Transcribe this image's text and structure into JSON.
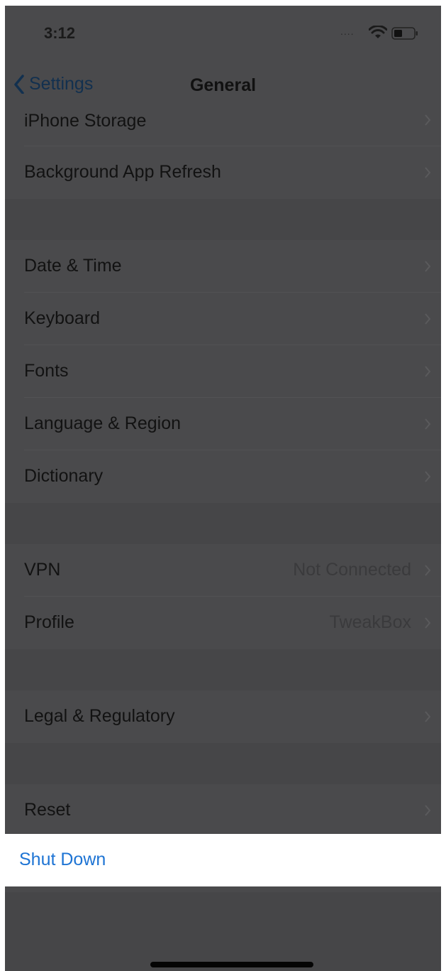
{
  "status_bar": {
    "time": "3:12",
    "signal_dots": "....",
    "wifi_icon": "wifi-icon",
    "battery_icon": "battery-icon"
  },
  "nav": {
    "back_label": "Settings",
    "title": "General"
  },
  "groups": [
    {
      "rows": [
        {
          "label": "iPhone Storage"
        },
        {
          "label": "Background App Refresh"
        }
      ]
    },
    {
      "rows": [
        {
          "label": "Date & Time"
        },
        {
          "label": "Keyboard"
        },
        {
          "label": "Fonts"
        },
        {
          "label": "Language & Region"
        },
        {
          "label": "Dictionary"
        }
      ]
    },
    {
      "rows": [
        {
          "label": "VPN",
          "value": "Not Connected"
        },
        {
          "label": "Profile",
          "value": "TweakBox"
        }
      ]
    },
    {
      "rows": [
        {
          "label": "Legal & Regulatory"
        }
      ]
    },
    {
      "rows": [
        {
          "label": "Reset"
        }
      ]
    }
  ],
  "shutdown": {
    "label": "Shut Down"
  },
  "colors": {
    "dimmed_background": "#4a4a4c",
    "highlight_row": "#ffffff",
    "link_blue": "#1e74d4"
  }
}
